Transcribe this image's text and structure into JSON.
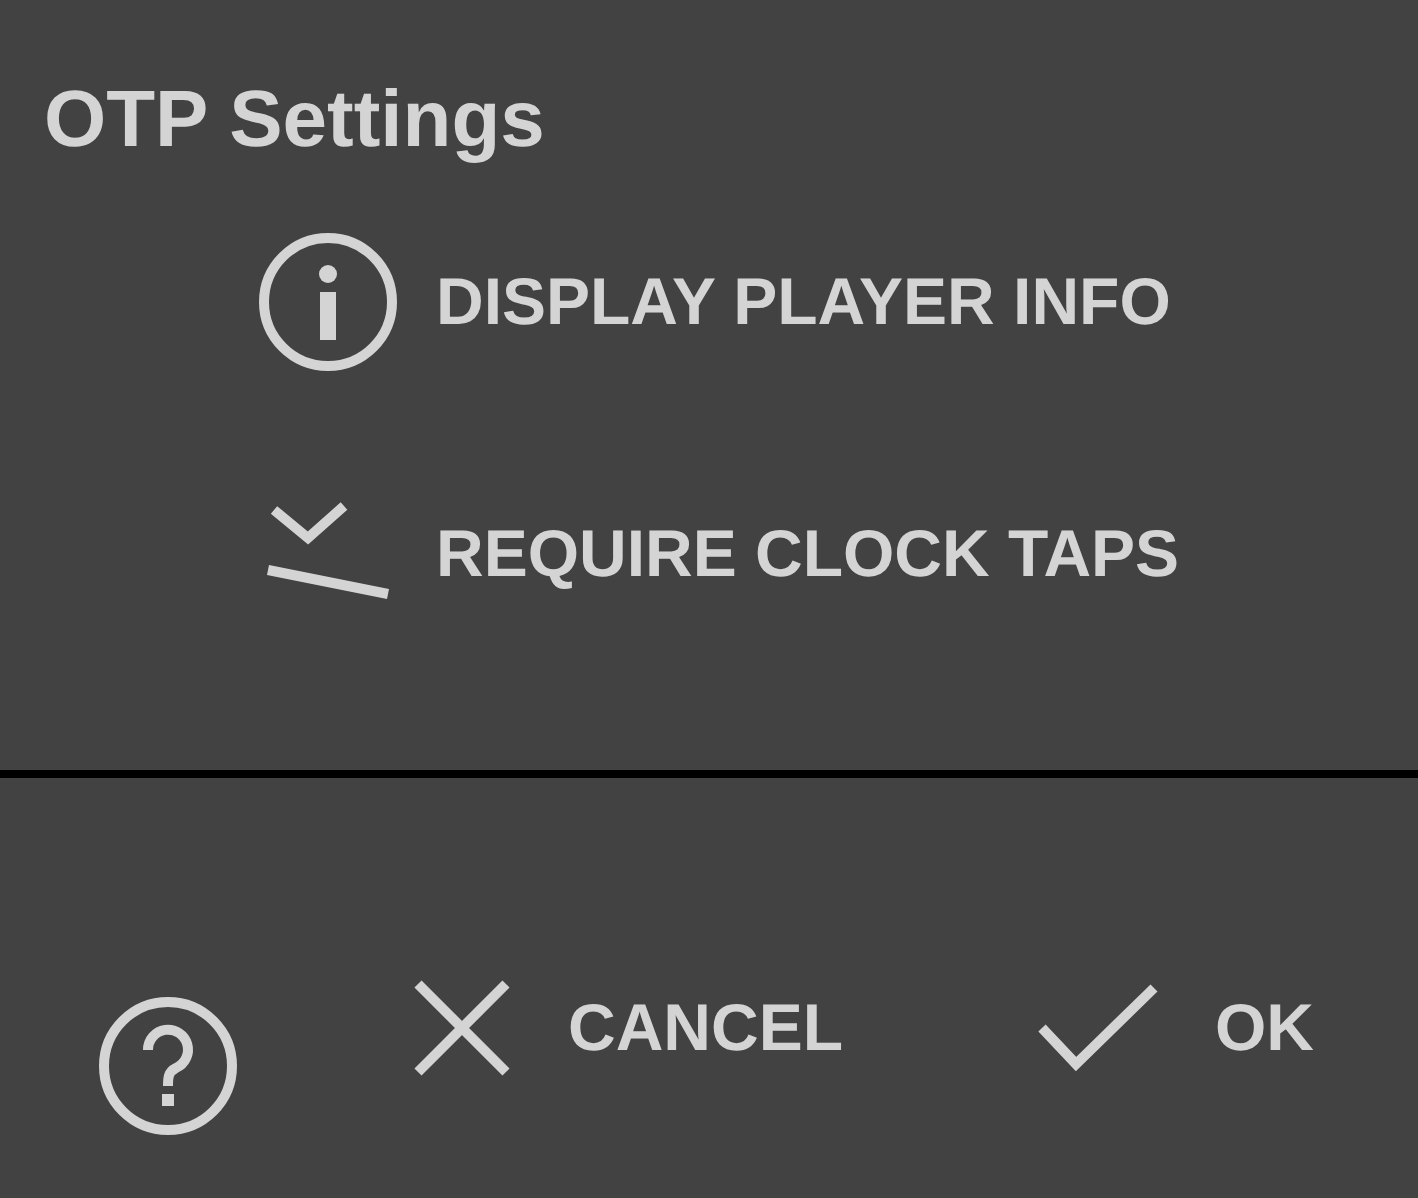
{
  "title": "OTP Settings",
  "options": [
    {
      "kind": "info",
      "label": "DISPLAY PLAYER INFO"
    },
    {
      "kind": "clock",
      "label": "REQUIRE CLOCK TAPS"
    }
  ],
  "buttons": [
    {
      "kind": "help"
    },
    {
      "kind": "cancel",
      "label": "CANCEL"
    },
    {
      "kind": "ok",
      "label": "OK"
    }
  ]
}
